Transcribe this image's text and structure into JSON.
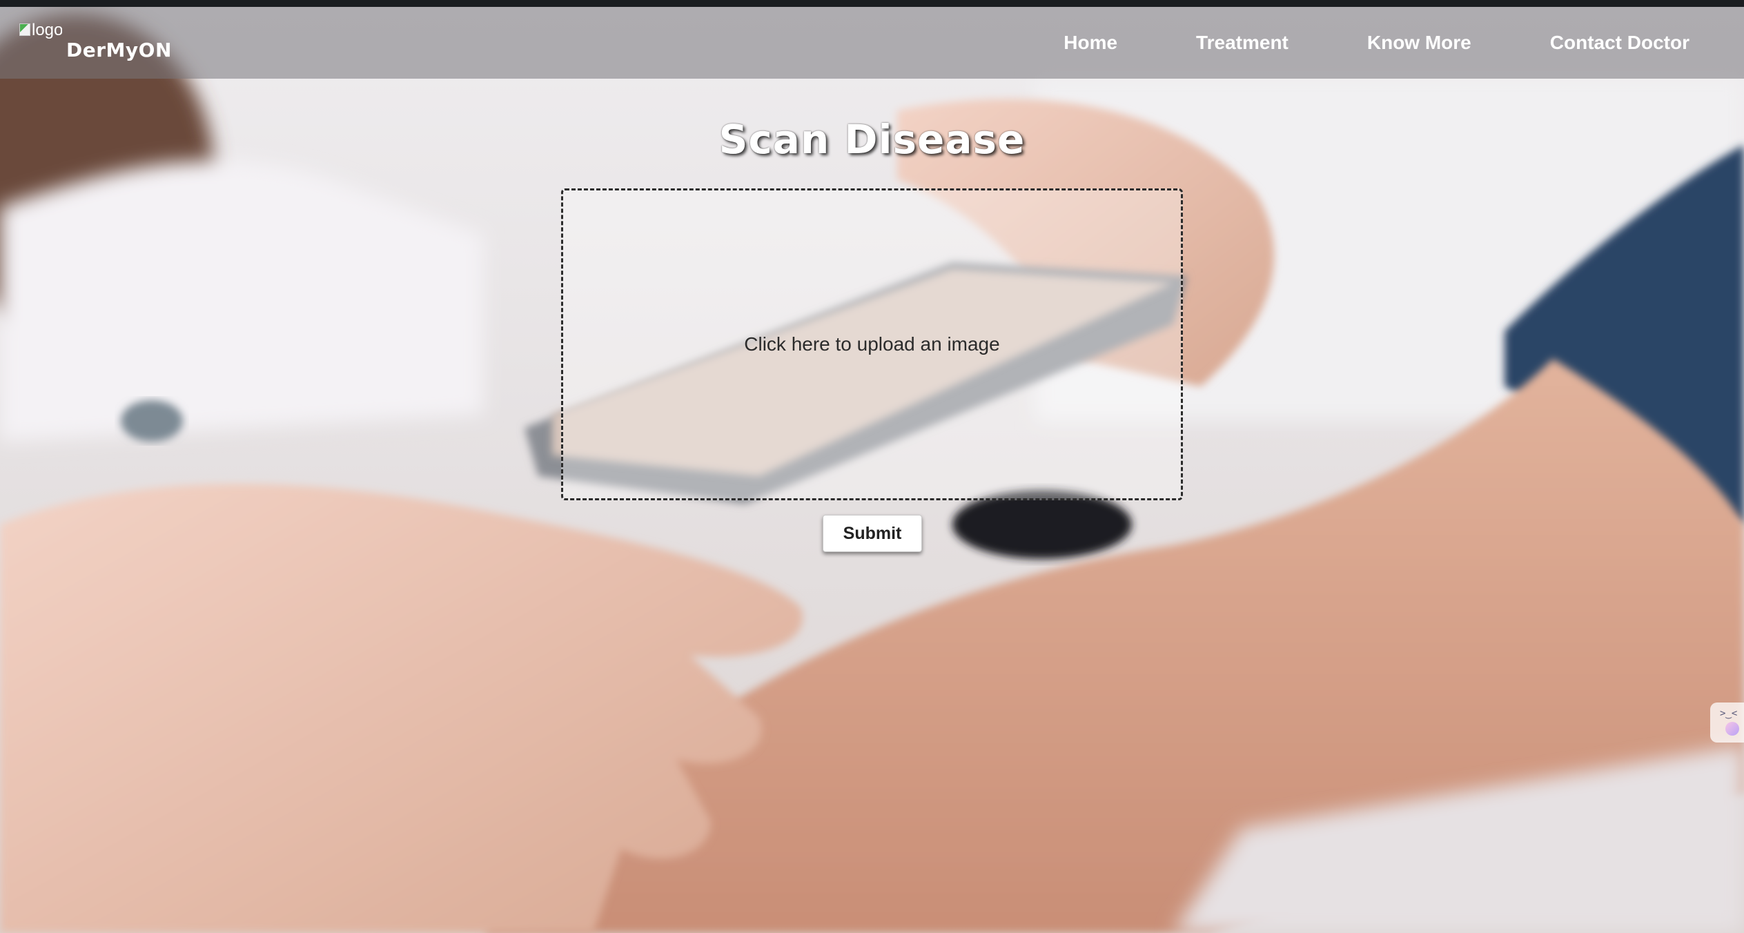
{
  "header": {
    "logo_alt": "logo",
    "brand": "DerMyON",
    "nav": [
      {
        "label": "Home"
      },
      {
        "label": "Treatment"
      },
      {
        "label": "Know More"
      },
      {
        "label": "Contact Doctor"
      }
    ]
  },
  "main": {
    "title": "Scan Disease",
    "upload_text": "Click here to upload an image",
    "submit_label": "Submit"
  },
  "widget": {
    "face": ">‿<"
  },
  "colors": {
    "navbar": "#78767c",
    "text_light": "#ffffff",
    "text_dark": "#2b2b2b"
  }
}
